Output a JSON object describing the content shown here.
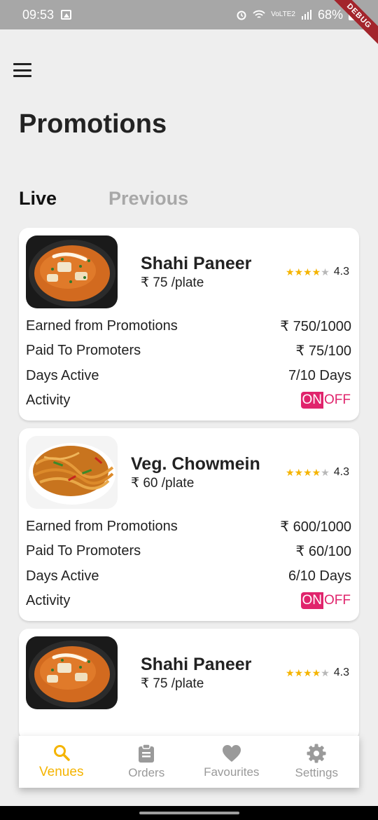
{
  "status_bar": {
    "time": "09:53",
    "battery": "68%",
    "debug_label": "DEBUG"
  },
  "header": {
    "title": "Promotions"
  },
  "tabs": [
    {
      "label": "Live"
    },
    {
      "label": "Previous"
    }
  ],
  "cards": [
    {
      "name": "Shahi Paneer",
      "price": "₹ 75 /plate",
      "rating": "4.3",
      "stars_filled": 4,
      "earned_label": "Earned from Promotions",
      "earned_value": "₹ 750/1000",
      "paid_label": "Paid To Promoters",
      "paid_value": "₹ 75/100",
      "days_label": "Days Active",
      "days_value": "7/10 Days",
      "activity_label": "Activity",
      "toggle_on": "ON",
      "toggle_off": "OFF"
    },
    {
      "name": "Veg. Chowmein",
      "price": "₹ 60 /plate",
      "rating": "4.3",
      "stars_filled": 4,
      "earned_label": "Earned from Promotions",
      "earned_value": "₹ 600/1000",
      "paid_label": "Paid To Promoters",
      "paid_value": "₹ 60/100",
      "days_label": "Days Active",
      "days_value": "6/10 Days",
      "activity_label": "Activity",
      "toggle_on": "ON",
      "toggle_off": "OFF"
    },
    {
      "name": "Shahi Paneer",
      "price": "₹ 75 /plate",
      "rating": "4.3",
      "stars_filled": 4
    }
  ],
  "bottom_nav": [
    {
      "label": "Venues",
      "icon": "search-icon",
      "active": true
    },
    {
      "label": "Orders",
      "icon": "clipboard-icon",
      "active": false
    },
    {
      "label": "Favourites",
      "icon": "heart-icon",
      "active": false
    },
    {
      "label": "Settings",
      "icon": "gear-icon",
      "active": false
    }
  ],
  "colors": {
    "accent": "#f5b400",
    "toggle": "#e0246c",
    "background": "#eeeeee"
  }
}
